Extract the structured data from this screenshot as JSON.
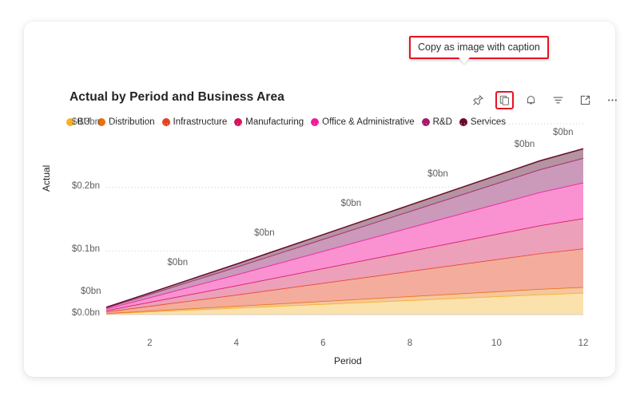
{
  "card": {
    "title": "Actual by Period and Business Area"
  },
  "tooltip": {
    "text": "Copy as image with caption",
    "border_color": "#e81123"
  },
  "toolbar": {
    "items": [
      {
        "name": "pin-icon",
        "label": "Pin to dashboard",
        "highlighted": false
      },
      {
        "name": "copy-icon",
        "label": "Copy as image with caption",
        "highlighted": true
      },
      {
        "name": "bell-icon",
        "label": "Alerts",
        "highlighted": false
      },
      {
        "name": "filter-icon",
        "label": "Filters",
        "highlighted": false
      },
      {
        "name": "focus-mode-icon",
        "label": "Focus mode",
        "highlighted": false
      },
      {
        "name": "more-options-icon",
        "label": "More options",
        "highlighted": false
      }
    ]
  },
  "chart_data": {
    "type": "area",
    "stacked": true,
    "title": "Actual by Period and Business Area",
    "xlabel": "Period",
    "ylabel": "Actual",
    "x": [
      1,
      2,
      3,
      4,
      5,
      6,
      7,
      8,
      9,
      10,
      11,
      12
    ],
    "xticks": [
      "2",
      "4",
      "6",
      "8",
      "10",
      "12"
    ],
    "xtick_values": [
      2,
      4,
      6,
      8,
      10,
      12
    ],
    "xlim": [
      1,
      12
    ],
    "yticks": [
      "$0.0bn",
      "$0.1bn",
      "$0.2bn",
      "$0.3bn"
    ],
    "ytick_values": [
      0,
      0.1,
      0.2,
      0.3
    ],
    "ylim": [
      0,
      0.3
    ],
    "grid": "horizontal-dotted",
    "legend_position": "top-left",
    "value_unit": "bn",
    "data_labels": [
      "$0bn",
      "$0bn",
      "$0bn",
      "$0bn",
      "$0bn",
      "$0bn",
      "$0bn"
    ],
    "data_label_x": [
      1,
      3,
      5,
      7,
      9,
      11,
      12
    ],
    "series": [
      {
        "name": "BU",
        "color": "#F5B324",
        "fill": "#FBDFA6",
        "values": [
          0.0015,
          0.0045,
          0.0075,
          0.0105,
          0.0135,
          0.0165,
          0.0195,
          0.0225,
          0.0255,
          0.0285,
          0.0315,
          0.034
        ]
      },
      {
        "name": "Distribution",
        "color": "#E8700F",
        "fill": "#F6C49A",
        "values": [
          0.0006,
          0.0014,
          0.0022,
          0.003,
          0.0038,
          0.0046,
          0.0054,
          0.0062,
          0.007,
          0.0078,
          0.0086,
          0.0092
        ]
      },
      {
        "name": "Infrastructure",
        "color": "#E8401F",
        "fill": "#F3A998",
        "values": [
          0.0025,
          0.0075,
          0.0125,
          0.0175,
          0.023,
          0.0285,
          0.034,
          0.0395,
          0.045,
          0.0505,
          0.056,
          0.0605
        ]
      },
      {
        "name": "Manufacturing",
        "color": "#D6115F",
        "fill": "#EC9BB6",
        "values": [
          0.002,
          0.0062,
          0.0104,
          0.0146,
          0.0188,
          0.023,
          0.0272,
          0.0314,
          0.0356,
          0.0398,
          0.044,
          0.0475
        ]
      },
      {
        "name": "Office & Administrative",
        "color": "#EE1C9B",
        "fill": "#FA8CD0",
        "values": [
          0.0024,
          0.0072,
          0.0122,
          0.0172,
          0.0222,
          0.0272,
          0.0322,
          0.0372,
          0.0422,
          0.0472,
          0.0522,
          0.0562
        ]
      },
      {
        "name": "R&D",
        "color": "#A51A6D",
        "fill": "#C894B6",
        "values": [
          0.0018,
          0.0052,
          0.0086,
          0.012,
          0.0154,
          0.0188,
          0.0222,
          0.0256,
          0.029,
          0.0324,
          0.0358,
          0.0386
        ]
      },
      {
        "name": "Services",
        "color": "#6B0A2E",
        "fill": "#B08E9B",
        "values": [
          0.0007,
          0.002,
          0.0033,
          0.0046,
          0.0059,
          0.0072,
          0.0085,
          0.0098,
          0.0111,
          0.0124,
          0.0137,
          0.0148
        ]
      }
    ]
  }
}
